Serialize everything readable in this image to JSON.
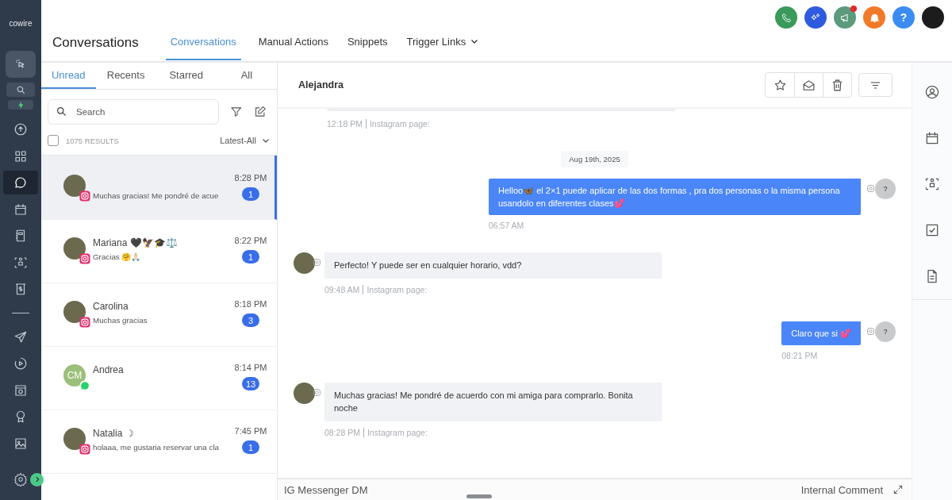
{
  "sidebar": {
    "logo": "cowire",
    "nav_items": [
      {
        "selected": false
      },
      {
        "selected": false
      },
      {
        "selected": true
      },
      {
        "selected": false
      },
      {
        "selected": false
      },
      {
        "selected": false
      },
      {
        "selected": false
      },
      {
        "selected": false
      },
      {
        "selected": false
      },
      {
        "selected": false
      },
      {
        "selected": false
      },
      {
        "selected": false
      }
    ]
  },
  "top_actions": [
    {
      "kind": "phone",
      "dot": false
    },
    {
      "kind": "sparkle",
      "dot": false
    },
    {
      "kind": "megaphone",
      "dot": true
    },
    {
      "kind": "bell",
      "dot": false
    },
    {
      "kind": "help",
      "label": "?",
      "dot": false
    },
    {
      "kind": "profile",
      "dot": false
    }
  ],
  "header": {
    "title": "Conversations",
    "tabs": [
      {
        "label": "Conversations",
        "selected": true,
        "dropdown": false
      },
      {
        "label": "Manual Actions",
        "selected": false,
        "dropdown": false
      },
      {
        "label": "Snippets",
        "selected": false,
        "dropdown": false
      },
      {
        "label": "Trigger Links",
        "selected": false,
        "dropdown": true
      }
    ]
  },
  "list_tabs": [
    {
      "label": "Unread",
      "selected": true
    },
    {
      "label": "Recents",
      "selected": false
    },
    {
      "label": "Starred",
      "selected": false
    },
    {
      "label": "All",
      "selected": false
    }
  ],
  "search": {
    "placeholder": "Search"
  },
  "results": {
    "checked": false,
    "count": "1075 RESULTS",
    "sort": "Latest-All"
  },
  "conversations": [
    {
      "preview": "Muchas gracias! Me pondré de acue",
      "time": "8:28 PM",
      "count": "1",
      "kind": "instagram",
      "selected": true
    },
    {
      "name": "Mariana 🖤🦅🎓⚖️",
      "preview": "Gracias 🤗🙏🏻",
      "time": "8:22 PM",
      "count": "1",
      "kind": "instagram",
      "selected": false
    },
    {
      "name": "Carolina",
      "preview": "Muchas gracias",
      "time": "8:18 PM",
      "count": "3",
      "kind": "instagram",
      "selected": false
    },
    {
      "name": "Andrea",
      "initials": "CM",
      "time": "8:14 PM",
      "count": "13",
      "kind": "whatsapp",
      "selected": false
    },
    {
      "name": "Natalia ☽",
      "preview": "holaaa, me gustaria reservar una cla",
      "time": "7:45 PM",
      "count": "1",
      "kind": "instagram",
      "selected": false
    }
  ],
  "chat": {
    "contact": "Alejandra",
    "messages": [
      {
        "kind": "stub",
        "time": "12:18 PM",
        "source": "Instagram page:"
      },
      {
        "kind": "date",
        "text": "Aug 19th, 2025"
      },
      {
        "kind": "outgoing",
        "text": "Helloo🦋 el 2×1 puede aplicar de las dos formas , pra dos personas o la misma persona usandolo en diferentes clases💕",
        "time": "06:57 AM",
        "avatar": "?"
      },
      {
        "kind": "incoming",
        "text": "Perfecto! Y puede ser en cualquier horario, vdd?",
        "time": "09:48 AM",
        "source": "Instagram page:"
      },
      {
        "kind": "outgoing",
        "text": "Claro que si 💕",
        "time": "08:21 PM",
        "avatar": "?"
      },
      {
        "kind": "incoming",
        "text": "Muchas gracias! Me pondré de acuerdo con mi amiga para comprarlo. Bonita noche",
        "time": "08:28 PM",
        "source": "Instagram page:"
      }
    ],
    "composer": {
      "channel": "IG Messenger DM",
      "mode": "Internal Comment"
    }
  }
}
